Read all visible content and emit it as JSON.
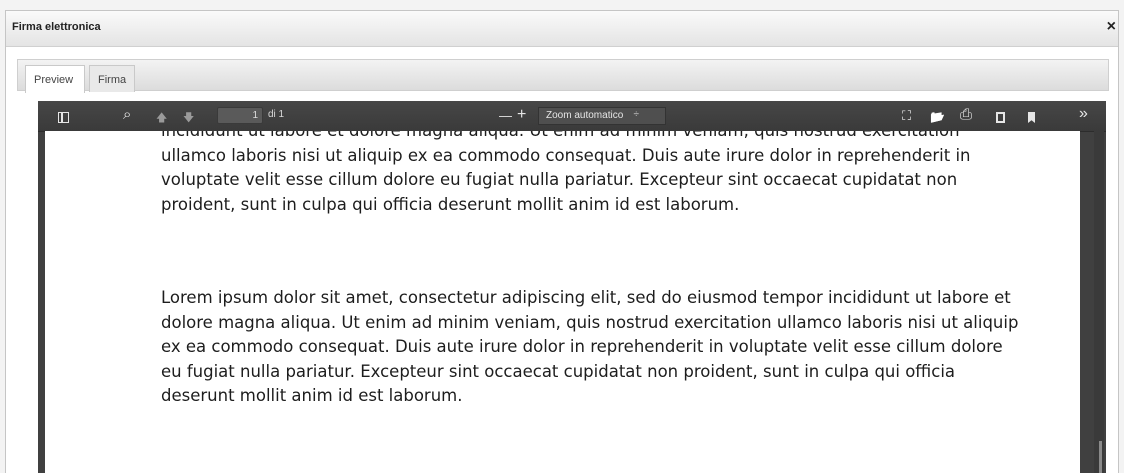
{
  "dialog": {
    "title": "Firma elettronica",
    "close_icon": "×"
  },
  "tabs": [
    {
      "label": "Preview"
    },
    {
      "label": "Firma"
    }
  ],
  "viewer": {
    "toolbar": {
      "sidebar_icon": "sidebar-toggle-icon",
      "search_icon": "⌕",
      "prev_icon": "🡅",
      "next_icon": "🡇",
      "page_number": "1",
      "page_of": "di 1",
      "zoom_out": "—",
      "zoom_in": "+",
      "zoom_value": "Zoom automatico",
      "zoom_arrow": "÷",
      "fullscreen_icon": "⛶",
      "open_icon": "📂",
      "print_icon": "⎙",
      "download_icon": "download-icon",
      "bookmark_icon": "bookmark-icon",
      "more_icon": "»"
    },
    "document": {
      "paragraph1": "incididunt ut labore et dolore magna aliqua. Ut enim ad minim veniam, quis nostrud exercitation ullamco laboris nisi ut aliquip ex ea commodo consequat. Duis aute irure dolor in reprehenderit in voluptate velit esse cillum dolore eu fugiat nulla pariatur. Excepteur sint occaecat cupidatat non proident, sunt in culpa qui officia deserunt mollit anim id est laborum.",
      "paragraph2": "Lorem ipsum dolor sit amet, consectetur adipiscing elit, sed do eiusmod tempor incididunt ut labore et dolore magna aliqua. Ut enim ad minim veniam, quis nostrud exercitation ullamco laboris nisi ut aliquip ex ea commodo consequat. Duis aute irure dolor in reprehenderit in voluptate velit esse cillum dolore eu fugiat nulla pariatur. Excepteur sint occaecat cupidatat non proident, sunt in culpa qui officia deserunt mollit anim id est laborum."
    }
  }
}
